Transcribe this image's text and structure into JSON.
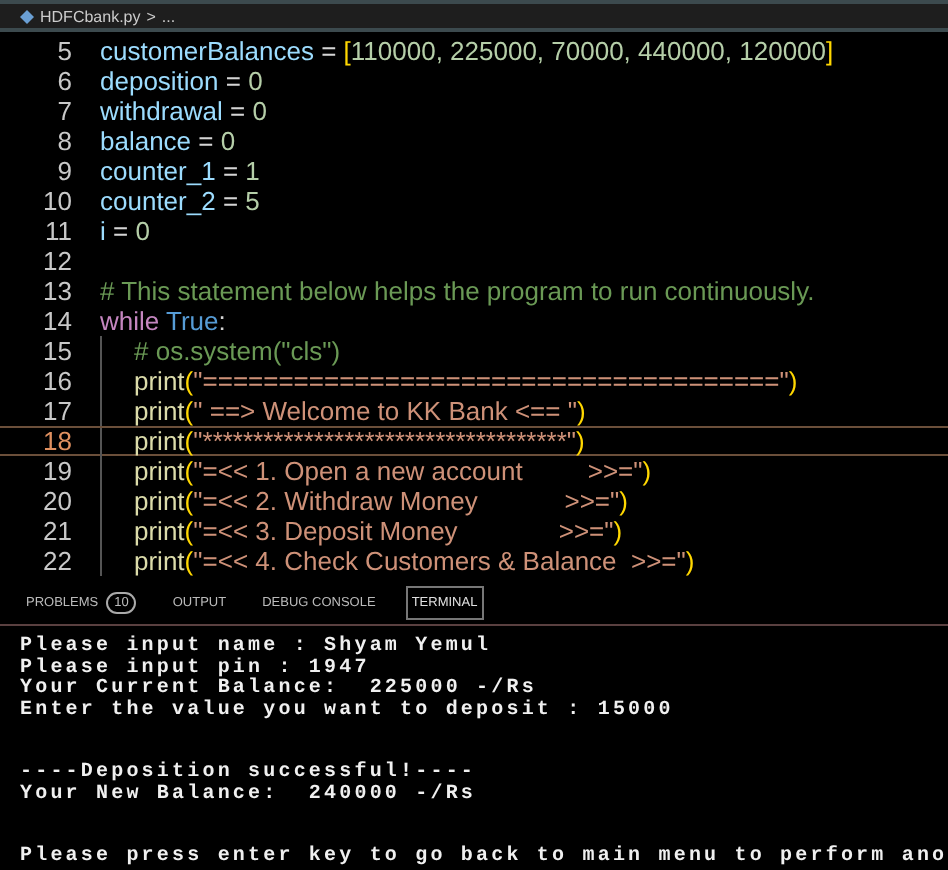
{
  "breadcrumb": {
    "file": "HDFCbank.py",
    "separator": ">",
    "trail": "..."
  },
  "editor": {
    "lines": [
      {
        "number": "5",
        "current": false,
        "tokens": [
          {
            "kind": "var",
            "text": "customerBalances"
          },
          {
            "kind": "op",
            "text": " = "
          },
          {
            "kind": "bracket",
            "text": "["
          },
          {
            "kind": "num",
            "text": "110000, 225000, 70000, 440000, 120000"
          },
          {
            "kind": "bracket",
            "text": "]"
          }
        ]
      },
      {
        "number": "6",
        "current": false,
        "tokens": [
          {
            "kind": "var",
            "text": "deposition"
          },
          {
            "kind": "op",
            "text": " = "
          },
          {
            "kind": "num",
            "text": "0"
          }
        ]
      },
      {
        "number": "7",
        "current": false,
        "tokens": [
          {
            "kind": "var",
            "text": "withdrawal"
          },
          {
            "kind": "op",
            "text": " = "
          },
          {
            "kind": "num",
            "text": "0"
          }
        ]
      },
      {
        "number": "8",
        "current": false,
        "tokens": [
          {
            "kind": "var",
            "text": "balance"
          },
          {
            "kind": "op",
            "text": " = "
          },
          {
            "kind": "num",
            "text": "0"
          }
        ]
      },
      {
        "number": "9",
        "current": false,
        "tokens": [
          {
            "kind": "var",
            "text": "counter_1"
          },
          {
            "kind": "op",
            "text": " = "
          },
          {
            "kind": "num",
            "text": "1"
          }
        ]
      },
      {
        "number": "10",
        "current": false,
        "tokens": [
          {
            "kind": "var",
            "text": "counter_2"
          },
          {
            "kind": "op",
            "text": " = "
          },
          {
            "kind": "num",
            "text": "5"
          }
        ]
      },
      {
        "number": "11",
        "current": false,
        "tokens": [
          {
            "kind": "var",
            "text": "i"
          },
          {
            "kind": "op",
            "text": " = "
          },
          {
            "kind": "num",
            "text": "0"
          }
        ]
      },
      {
        "number": "12",
        "current": false
      },
      {
        "number": "13",
        "current": false,
        "tokens": [
          {
            "kind": "comment",
            "text": "# This statement below helps the program to run continuously."
          }
        ]
      },
      {
        "number": "14",
        "current": false,
        "tokens": [
          {
            "kind": "keyword",
            "text": "while"
          },
          {
            "kind": "const",
            "text": " True"
          },
          {
            "kind": "op",
            "text": ":"
          }
        ],
        "children": [
          {
            "number": "15",
            "current": false,
            "tokens": [
              {
                "kind": "comment",
                "text": "# os.system(\"cls\")"
              }
            ]
          },
          {
            "number": "16",
            "current": false,
            "tokens": [
              {
                "kind": "func",
                "text": "print"
              },
              {
                "kind": "paren",
                "text": "("
              },
              {
                "kind": "str",
                "text": "\"======================================\""
              },
              {
                "kind": "paren",
                "text": ")"
              }
            ]
          },
          {
            "number": "17",
            "current": false,
            "tokens": [
              {
                "kind": "func",
                "text": "print"
              },
              {
                "kind": "paren",
                "text": "("
              },
              {
                "kind": "str",
                "text": "\" ==> Welcome to KK Bank <== \""
              },
              {
                "kind": "paren",
                "text": ")"
              }
            ]
          },
          {
            "number": "18",
            "current": true,
            "tokens": [
              {
                "kind": "func",
                "text": "print"
              },
              {
                "kind": "paren",
                "text": "("
              },
              {
                "kind": "str",
                "text": "\"************************************\""
              },
              {
                "kind": "paren",
                "text": ")"
              }
            ]
          },
          {
            "number": "19",
            "current": false,
            "tokens": [
              {
                "kind": "func",
                "text": "print"
              },
              {
                "kind": "paren",
                "text": "("
              },
              {
                "kind": "str",
                "text": "\"=<< 1. Open a new account         >>=\""
              },
              {
                "kind": "paren",
                "text": ")"
              }
            ]
          },
          {
            "number": "20",
            "current": false,
            "tokens": [
              {
                "kind": "func",
                "text": "print"
              },
              {
                "kind": "paren",
                "text": "("
              },
              {
                "kind": "str",
                "text": "\"=<< 2. Withdraw Money            >>=\""
              },
              {
                "kind": "paren",
                "text": ")"
              }
            ]
          },
          {
            "number": "21",
            "current": false,
            "tokens": [
              {
                "kind": "func",
                "text": "print"
              },
              {
                "kind": "paren",
                "text": "("
              },
              {
                "kind": "str",
                "text": "\"=<< 3. Deposit Money              >>=\""
              },
              {
                "kind": "paren",
                "text": ")"
              }
            ]
          },
          {
            "number": "22",
            "current": false,
            "tokens": [
              {
                "kind": "func",
                "text": "print"
              },
              {
                "kind": "paren",
                "text": "("
              },
              {
                "kind": "str",
                "text": "\"=<< 4. Check Customers & Balance  >>=\""
              },
              {
                "kind": "paren",
                "text": ")"
              }
            ]
          }
        ]
      }
    ]
  },
  "panel": {
    "tabs": [
      {
        "label": "PROBLEMS",
        "badge": "10",
        "selected": false
      },
      {
        "label": "OUTPUT",
        "selected": false
      },
      {
        "label": "DEBUG CONSOLE",
        "selected": false
      },
      {
        "label": "TERMINAL",
        "selected": true
      }
    ]
  },
  "terminal": {
    "blocks": [
      [
        "Please input name : Shyam Yemul",
        "Please input pin : 1947",
        "Your Current Balance:  225000 -/Rs",
        "Enter the value you want to deposit : 15000"
      ],
      [
        "----Deposition successful!----",
        "Your New Balance:  240000 -/Rs"
      ],
      [
        "Please press enter key to go back to main menu to perform ano"
      ]
    ]
  }
}
